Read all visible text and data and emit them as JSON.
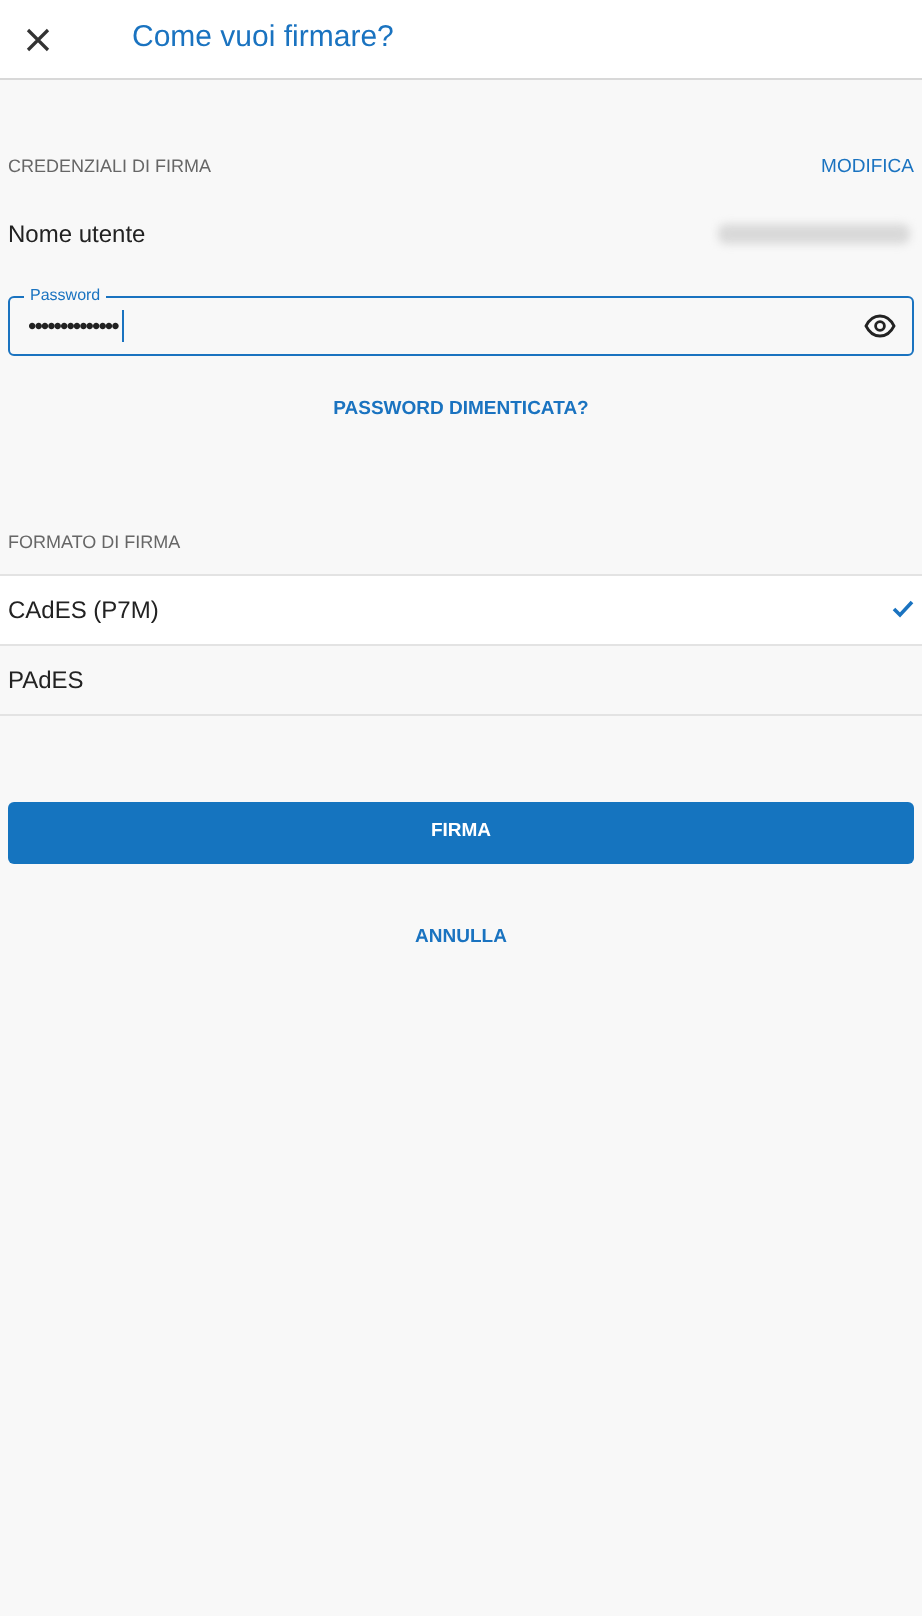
{
  "header": {
    "title": "Come vuoi firmare?"
  },
  "credentials": {
    "section_label": "CREDENZIALI DI FIRMA",
    "edit_link": "MODIFICA",
    "username_label": "Nome utente",
    "password": {
      "label": "Password",
      "value": "••••••••••••••"
    },
    "forgot_link": "PASSWORD DIMENTICATA?"
  },
  "format": {
    "section_label": "FORMATO DI FIRMA",
    "options": [
      {
        "label": "CAdES (P7M)",
        "selected": true
      },
      {
        "label": "PAdES",
        "selected": false
      }
    ]
  },
  "actions": {
    "primary": "FIRMA",
    "secondary": "ANNULLA"
  }
}
